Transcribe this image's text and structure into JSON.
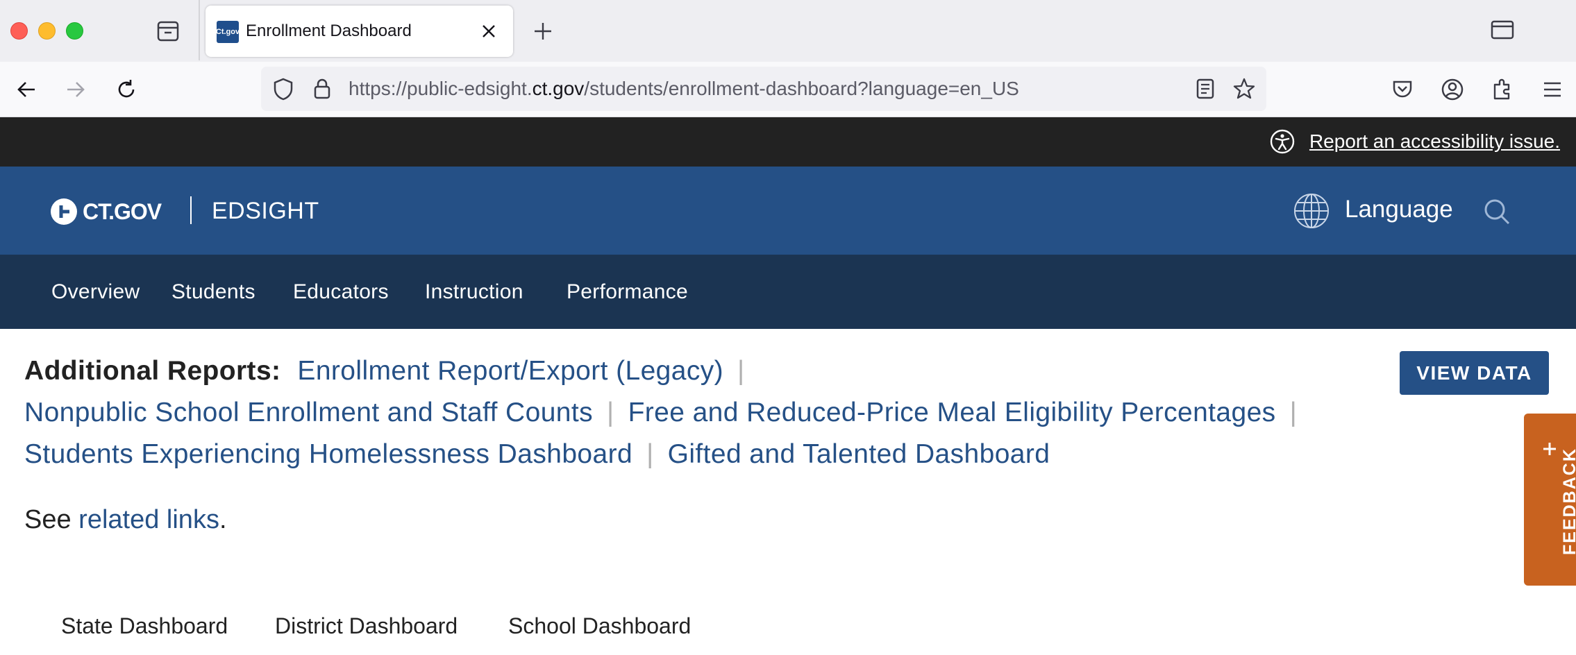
{
  "browser": {
    "tab_title": "Enrollment Dashboard",
    "favicon_text": "Ct.gov",
    "url_prefix": "https://public-edsight.",
    "url_domain": "ct.gov",
    "url_suffix": "/students/enrollment-dashboard?language=en_US"
  },
  "accessibility": {
    "link_text": "Report an accessibility issue."
  },
  "header": {
    "logo_text": "CT.GOV",
    "site_name": "EDSIGHT",
    "language_label": "Language"
  },
  "main_nav": {
    "items": [
      "Overview",
      "Students",
      "Educators",
      "Instruction",
      "Performance"
    ]
  },
  "reports": {
    "label": "Additional Reports:",
    "links": [
      "Enrollment Report/Export (Legacy)",
      "Nonpublic School Enrollment and Staff Counts",
      "Free and Reduced-Price Meal Eligibility Percentages",
      "Students Experiencing Homelessness Dashboard",
      "Gifted and Talented Dashboard"
    ],
    "separator": "|"
  },
  "view_data_label": "VIEW DATA",
  "see": {
    "prefix": "See ",
    "link": "related links",
    "suffix": "."
  },
  "feedback_label": "FEEDBACK",
  "dashboard_tabs": [
    "State Dashboard",
    "District Dashboard",
    "School Dashboard"
  ],
  "colors": {
    "brand_blue": "#255086",
    "nav_dark": "#1b3452",
    "feedback_orange": "#c8621f",
    "a11y_bar": "#222222"
  }
}
